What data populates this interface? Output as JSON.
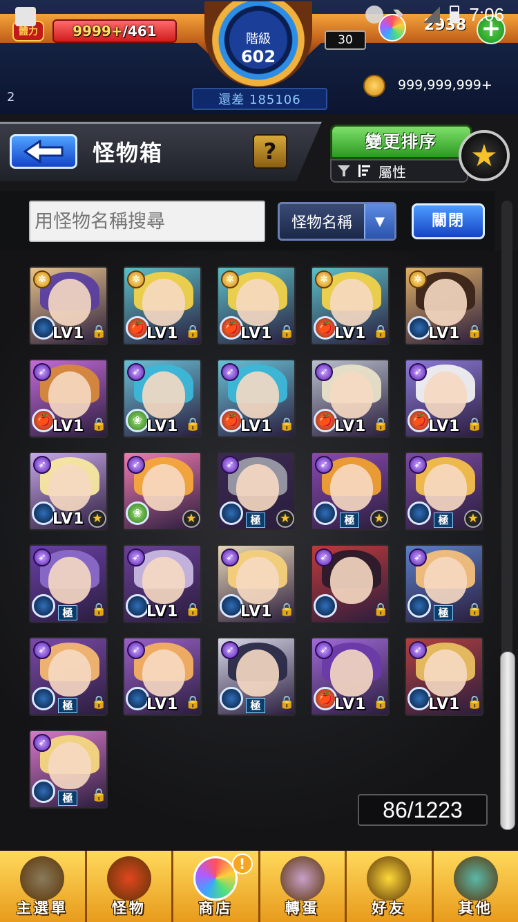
{
  "status_bar": {
    "time": "7:06"
  },
  "hud": {
    "stamina_label": "體力",
    "stamina_current": "9999+",
    "stamina_max": "/461",
    "rank_label": "階級",
    "rank_value": "602",
    "rank_remaining": "還差 185106",
    "chest_count": "30",
    "orb_count": "2938",
    "left_indicator": "2",
    "coins": "999,999,999+"
  },
  "title_bar": {
    "title": "怪物箱",
    "help_label": "?",
    "sort_label": "變更排序",
    "filter_label": "屬性"
  },
  "search": {
    "placeholder": "用怪物名稱搜尋",
    "type_label": "怪物名稱",
    "close_label": "關閉"
  },
  "monsters": [
    {
      "level": "LV1",
      "status": "lock",
      "type": "light",
      "element": "dark",
      "hair": "#5a3fa0",
      "bg": "#e8c48c"
    },
    {
      "level": "LV1",
      "status": "lock",
      "type": "light",
      "element": "fire",
      "hair": "#f2d24a",
      "bg": "#5bc0c8"
    },
    {
      "level": "LV1",
      "status": "lock",
      "type": "light",
      "element": "fire",
      "hair": "#f2d24a",
      "bg": "#5bc0c8"
    },
    {
      "level": "LV1",
      "status": "lock",
      "type": "light",
      "element": "fire",
      "hair": "#f2d24a",
      "bg": "#5bc0c8"
    },
    {
      "level": "LV1",
      "status": "lock",
      "type": "light",
      "element": "dark",
      "hair": "#3a2418",
      "bg": "#e0b066"
    },
    {
      "level": "LV1",
      "status": "lock",
      "type": "dark",
      "element": "fire",
      "hair": "#d7893a",
      "bg": "#c46bd8"
    },
    {
      "level": "LV1",
      "status": "lock",
      "type": "dark",
      "element": "wood",
      "hair": "#3cb7d8",
      "bg": "#6ac0d6"
    },
    {
      "level": "LV1",
      "status": "lock",
      "type": "dark",
      "element": "fire",
      "hair": "#3cb7d8",
      "bg": "#6ac0d6"
    },
    {
      "level": "LV1",
      "status": "lock",
      "type": "dark",
      "element": "fire",
      "hair": "#e8e0c8",
      "bg": "#b8c0cc"
    },
    {
      "level": "LV1",
      "status": "lock",
      "type": "dark",
      "element": "fire",
      "hair": "#f0f0f0",
      "bg": "#8c7ad8"
    },
    {
      "level": "LV1",
      "status": "star",
      "type": "dark",
      "element": "dark",
      "hair": "#f8e8a0",
      "bg": "#c8a8e8"
    },
    {
      "level": "",
      "status": "star",
      "type": "dark",
      "element": "wood",
      "hair": "#f4a83a",
      "bg": "#f07ab0"
    },
    {
      "level": "極",
      "status": "star",
      "type": "dark",
      "element": "dark",
      "hair": "#9a9aa8",
      "bg": "#3a2a50"
    },
    {
      "level": "極",
      "status": "star",
      "type": "dark",
      "element": "dark",
      "hair": "#f0a030",
      "bg": "#8a4ab0"
    },
    {
      "level": "極",
      "status": "star",
      "type": "dark",
      "element": "dark",
      "hair": "#f4c04a",
      "bg": "#7a4aa0"
    },
    {
      "level": "極",
      "status": "lock",
      "type": "dark",
      "element": "dark",
      "hair": "#8a6ac8",
      "bg": "#6a40a8"
    },
    {
      "level": "LV1",
      "status": "lock",
      "type": "dark",
      "element": "dark",
      "hair": "#c8b8e0",
      "bg": "#6a4098"
    },
    {
      "level": "LV1",
      "status": "lock",
      "type": "dark",
      "element": "dark",
      "hair": "#f4d07a",
      "bg": "#e8d8b8"
    },
    {
      "level": "",
      "status": "lock",
      "type": "dark",
      "element": "dark",
      "hair": "#2a1a2a",
      "bg": "#c03a3a"
    },
    {
      "level": "極",
      "status": "lock",
      "type": "dark",
      "element": "dark",
      "hair": "#f4c07a",
      "bg": "#5a80c8"
    },
    {
      "level": "極",
      "status": "lock",
      "type": "dark",
      "element": "dark",
      "hair": "#f4b870",
      "bg": "#7a4aa8"
    },
    {
      "level": "LV1",
      "status": "lock",
      "type": "dark",
      "element": "dark",
      "hair": "#f4b060",
      "bg": "#9a60c8"
    },
    {
      "level": "極",
      "status": "lock",
      "type": "dark",
      "element": "dark",
      "hair": "#2a2a48",
      "bg": "#d8d8e8"
    },
    {
      "level": "LV1",
      "status": "lock",
      "type": "dark",
      "element": "fire",
      "hair": "#6a3aa8",
      "bg": "#a06ad8"
    },
    {
      "level": "LV1",
      "status": "lock",
      "type": "dark",
      "element": "dark",
      "hair": "#e8c060",
      "bg": "#b04040"
    },
    {
      "level": "極",
      "status": "lock",
      "type": "dark",
      "element": "dark",
      "hair": "#f4d880",
      "bg": "#d878c8"
    }
  ],
  "box_count": "86/1223",
  "nav": [
    {
      "label": "主選單",
      "icon": "home-gate-icon",
      "color": "#8a7a5a",
      "badge": ""
    },
    {
      "label": "怪物",
      "icon": "monster-icon",
      "color": "#e2461e",
      "badge": ""
    },
    {
      "label": "商店",
      "icon": "rainbow-orb-icon",
      "color": "#7fbfff",
      "badge": "!"
    },
    {
      "label": "轉蛋",
      "icon": "gacha-characters-icon",
      "color": "#c8a0c8",
      "badge": ""
    },
    {
      "label": "好友",
      "icon": "friends-balloon-icon",
      "color": "#ffd93a",
      "badge": ""
    },
    {
      "label": "其他",
      "icon": "question-diamond-icon",
      "color": "#5ab8a8",
      "badge": ""
    }
  ]
}
